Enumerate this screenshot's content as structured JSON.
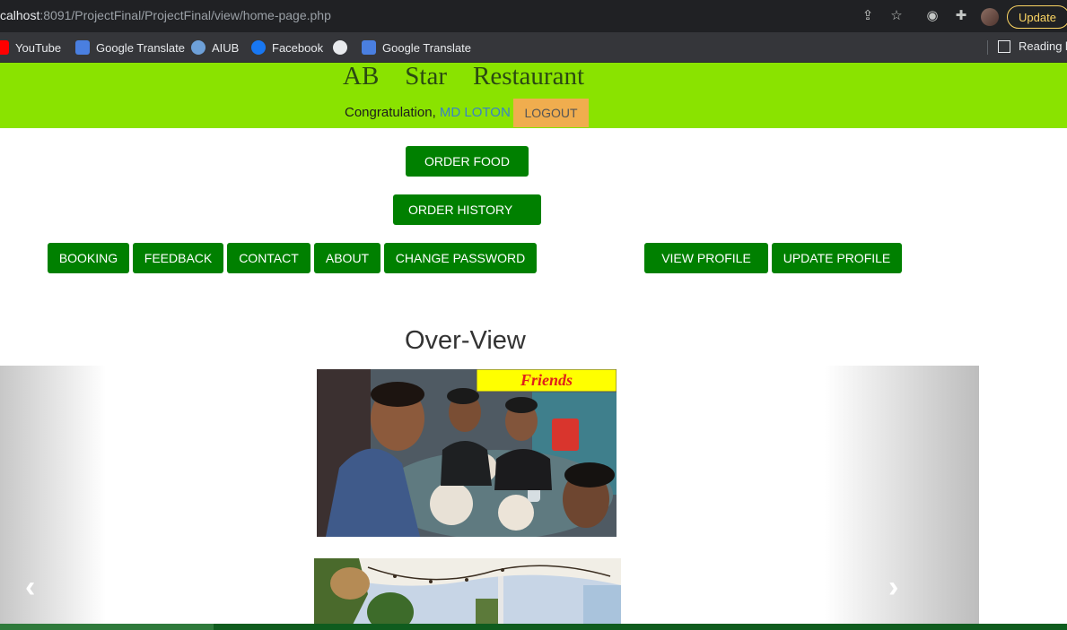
{
  "browser": {
    "url_host": "calhost",
    "url_path": ":8091/ProjectFinal/ProjectFinal/view/home-page.php",
    "update_label": "Update",
    "bookmarks": [
      "YouTube",
      "Google Translate",
      "AIUB",
      "Facebook",
      "",
      "Google Translate"
    ],
    "reading_list": "Reading li"
  },
  "header": {
    "title": "AB    Star    Restaurant",
    "greeting": "Congratulation, ",
    "username": "MD LOTON",
    "logout_label": "LOGOUT"
  },
  "nav": {
    "order_food": "ORDER FOOD",
    "order_history": "ORDER HISTORY",
    "booking": "BOOKING",
    "feedback": "FEEDBACK",
    "contact": "CONTACT",
    "about": "ABOUT",
    "change_password": "CHANGE PASSWORD",
    "view_profile": "VIEW PROFILE",
    "update_profile": "UPDATE PROFILE"
  },
  "overview": {
    "heading": "Over-View",
    "photo1_caption": "Friends"
  },
  "colors": {
    "header_bg": "#8ae300",
    "button_green": "#008000",
    "logout_orange": "#f0ad4e"
  }
}
